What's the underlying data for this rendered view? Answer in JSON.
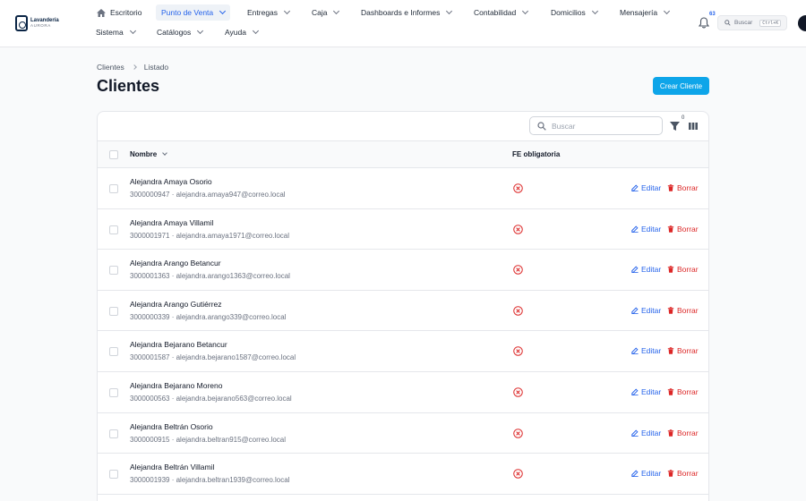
{
  "logo": {
    "line1": "Lavandería",
    "line2": "AURORA"
  },
  "nav": {
    "home": "Escritorio",
    "items": [
      {
        "label": "Punto de Venta"
      },
      {
        "label": "Entregas"
      },
      {
        "label": "Caja"
      },
      {
        "label": "Dashboards e Informes"
      },
      {
        "label": "Contabilidad"
      },
      {
        "label": "Domicilios"
      },
      {
        "label": "Mensajería"
      },
      {
        "label": "Sistema"
      },
      {
        "label": "Catálogos"
      },
      {
        "label": "Ayuda"
      }
    ],
    "notifications_count": "63",
    "search_label": "Buscar",
    "search_shortcut": "Ctrl+K"
  },
  "breadcrumb": [
    "Clientes",
    "Listado"
  ],
  "page": {
    "title": "Clientes",
    "create_label": "Crear Cliente"
  },
  "table": {
    "search_placeholder": "Buscar",
    "filter_count": "0",
    "columns": {
      "name": "Nombre",
      "fe": "FE obligatoria"
    },
    "edit_label": "Editar",
    "delete_label": "Borrar",
    "rows": [
      {
        "name": "Alejandra Amaya Osorio",
        "meta": "3000000947 · alejandra.amaya947@correo.local"
      },
      {
        "name": "Alejandra Amaya Villamil",
        "meta": "3000001971 · alejandra.amaya1971@correo.local"
      },
      {
        "name": "Alejandra Arango Betancur",
        "meta": "3000001363 · alejandra.arango1363@correo.local"
      },
      {
        "name": "Alejandra Arango Gutiérrez",
        "meta": "3000000339 · alejandra.arango339@correo.local"
      },
      {
        "name": "Alejandra Bejarano Betancur",
        "meta": "3000001587 · alejandra.bejarano1587@correo.local"
      },
      {
        "name": "Alejandra Bejarano Moreno",
        "meta": "3000000563 · alejandra.bejarano563@correo.local"
      },
      {
        "name": "Alejandra Beltrán Osorio",
        "meta": "3000000915 · alejandra.beltran915@correo.local"
      },
      {
        "name": "Alejandra Beltrán Villamil",
        "meta": "3000001939 · alejandra.beltran1939@correo.local"
      }
    ]
  },
  "colors": {
    "primary": "#2563eb",
    "create_button": "#0ea5e9",
    "danger": "#dc2626"
  }
}
